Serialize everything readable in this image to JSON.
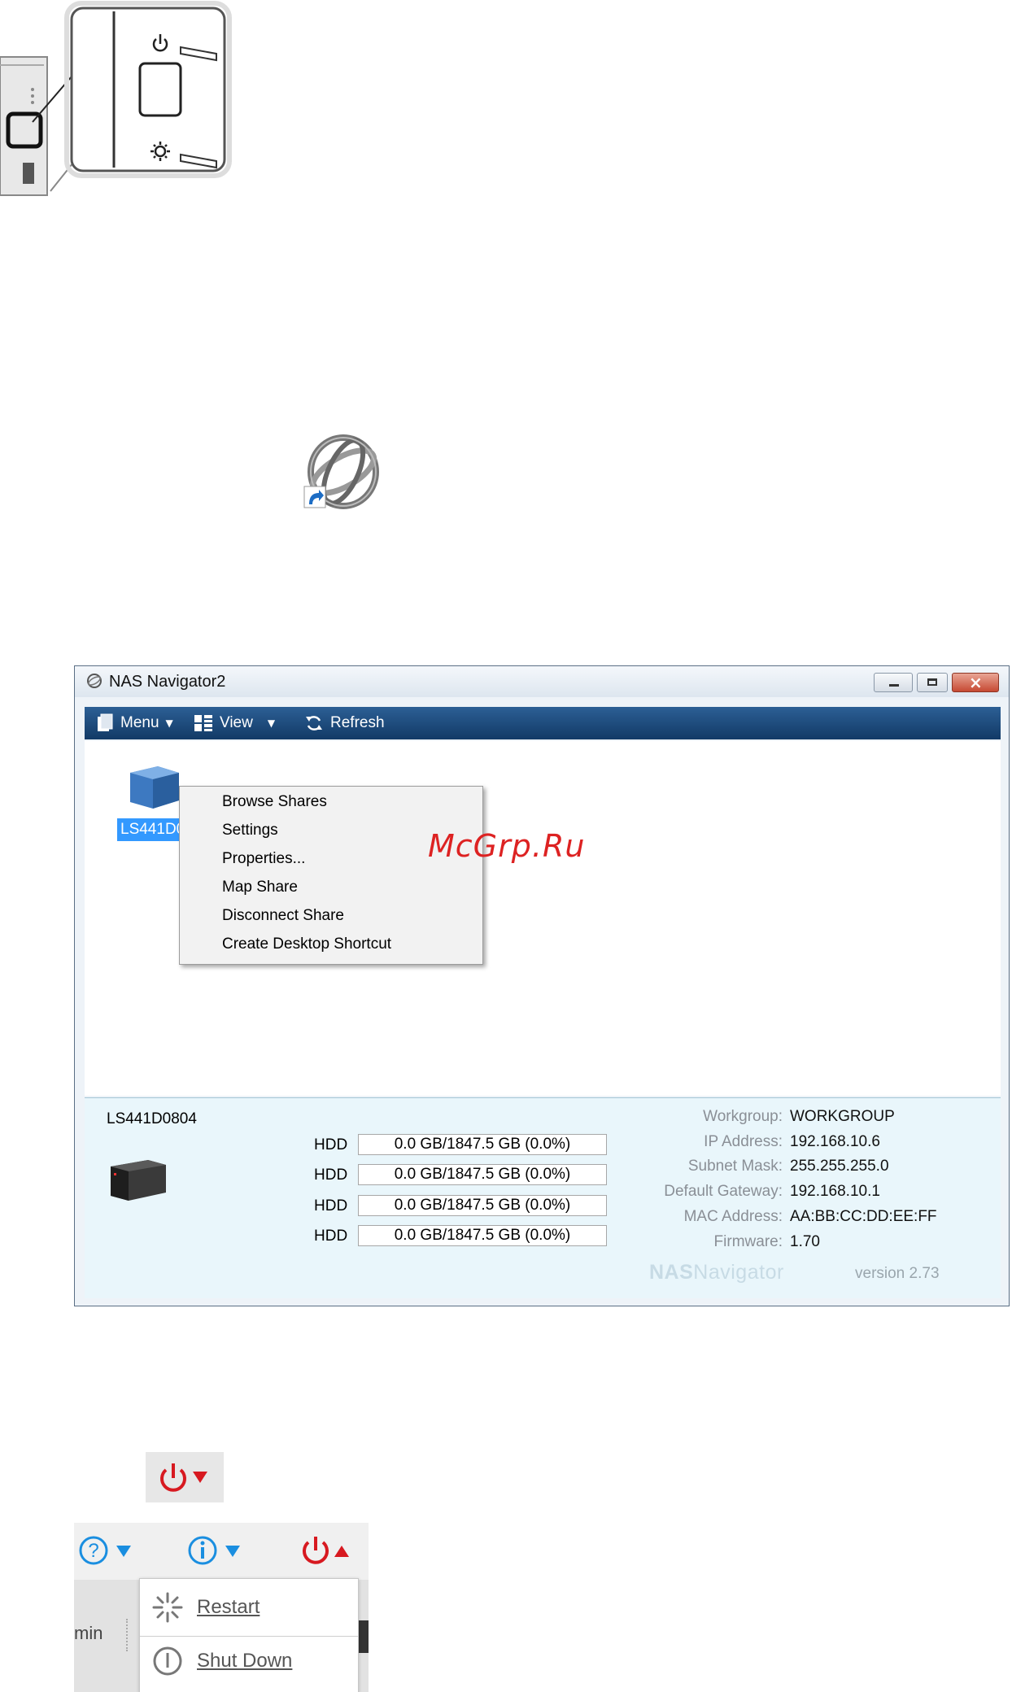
{
  "window": {
    "title": "NAS Navigator2",
    "toolbar": {
      "menu": "Menu",
      "view": "View",
      "refresh": "Refresh"
    }
  },
  "device_list": {
    "selected_label": "LS441D0804"
  },
  "context_menu": {
    "items": [
      "Browse Shares",
      "Settings",
      "Properties...",
      "Map Share",
      "Disconnect Share",
      "Create Desktop Shortcut"
    ]
  },
  "info_panel": {
    "device_name": "LS441D0804",
    "drives": [
      {
        "label": "HDD",
        "usage": "0.0 GB/1847.5 GB (0.0%)"
      },
      {
        "label": "HDD",
        "usage": "0.0 GB/1847.5 GB (0.0%)"
      },
      {
        "label": "HDD",
        "usage": "0.0 GB/1847.5 GB (0.0%)"
      },
      {
        "label": "HDD",
        "usage": "0.0 GB/1847.5 GB (0.0%)"
      }
    ],
    "fields": [
      {
        "key": "Workgroup:",
        "value": "WORKGROUP"
      },
      {
        "key": "IP Address:",
        "value": "192.168.10.6"
      },
      {
        "key": "Subnet Mask:",
        "value": "255.255.255.0"
      },
      {
        "key": "Default Gateway:",
        "value": "192.168.10.1"
      },
      {
        "key": "MAC Address:",
        "value": "AA:BB:CC:DD:EE:FF"
      },
      {
        "key": "Firmware:",
        "value": "1.70"
      }
    ],
    "brand_bold": "NAS",
    "brand_light": "Navigator",
    "version": "version 2.73"
  },
  "watermark": "McGrp.Ru",
  "web_ui": {
    "partial_label": "min",
    "power_menu": {
      "restart": "Restart",
      "shutdown": "Shut Down"
    }
  },
  "colors": {
    "toolbar": "#1f4d7f",
    "power_red": "#d71920",
    "help_blue": "#1a8ee0",
    "selection": "#3399ff"
  },
  "icons": [
    "power-icon",
    "function-icon",
    "nas-navigator-icon",
    "help-icon",
    "info-icon",
    "restart-icon",
    "shutdown-icon"
  ]
}
